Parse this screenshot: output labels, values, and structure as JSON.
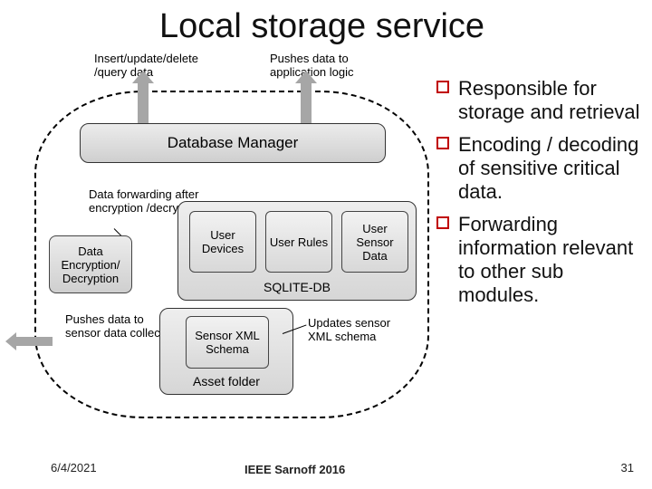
{
  "title": "Local storage service",
  "annotations": {
    "insert_query": "Insert/update/delete /query data",
    "push_app": "Pushes data to application logic",
    "fwd_after_enc": "Data forwarding after encryption /decryption",
    "push_sdc": "Pushes data to sensor data collector",
    "updates_schema": "Updates sensor XML schema"
  },
  "blocks": {
    "db_manager": "Database Manager",
    "encryption": "Data Encryption/ Decryption",
    "sqlite": {
      "label": "SQLITE-DB",
      "items": [
        "User Devices",
        "User Rules",
        "User Sensor Data"
      ]
    },
    "asset": {
      "label": "Asset folder",
      "schema": "Sensor XML Schema"
    }
  },
  "bullets": [
    "Responsible for storage and retrieval",
    "Encoding / decoding of sensitive critical data.",
    "Forwarding information relevant to other sub modules."
  ],
  "footer": {
    "date": "6/4/2021",
    "conference": "IEEE Sarnoff 2016",
    "page": "31"
  }
}
